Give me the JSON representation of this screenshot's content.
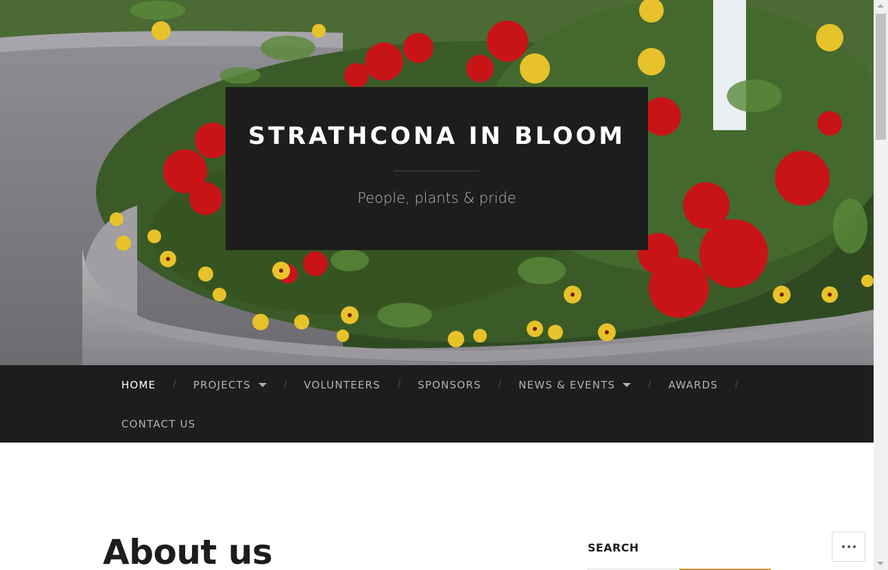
{
  "header": {
    "site_title": "STRATHCONA IN BLOOM",
    "tagline": "People, plants & pride",
    "hero_image": "flower-planter-photo"
  },
  "nav": {
    "items": [
      {
        "label": "HOME",
        "active": true,
        "has_dropdown": false
      },
      {
        "label": "PROJECTS",
        "active": false,
        "has_dropdown": true
      },
      {
        "label": "VOLUNTEERS",
        "active": false,
        "has_dropdown": false
      },
      {
        "label": "SPONSORS",
        "active": false,
        "has_dropdown": false
      },
      {
        "label": "NEWS & EVENTS",
        "active": false,
        "has_dropdown": true
      },
      {
        "label": "AWARDS",
        "active": false,
        "has_dropdown": false
      },
      {
        "label": "CONTACT US",
        "active": false,
        "has_dropdown": false
      }
    ],
    "separator": "/"
  },
  "main": {
    "post_title": "About us"
  },
  "sidebar": {
    "search_title": "SEARCH",
    "search_placeholder": ""
  },
  "widgets": {
    "more_icon": "ellipsis-icon"
  },
  "colors": {
    "dark": "#1d1d1d",
    "accent": "#ca9e3a",
    "nav_text": "#b3b3b3",
    "nav_active": "#ffffff"
  }
}
